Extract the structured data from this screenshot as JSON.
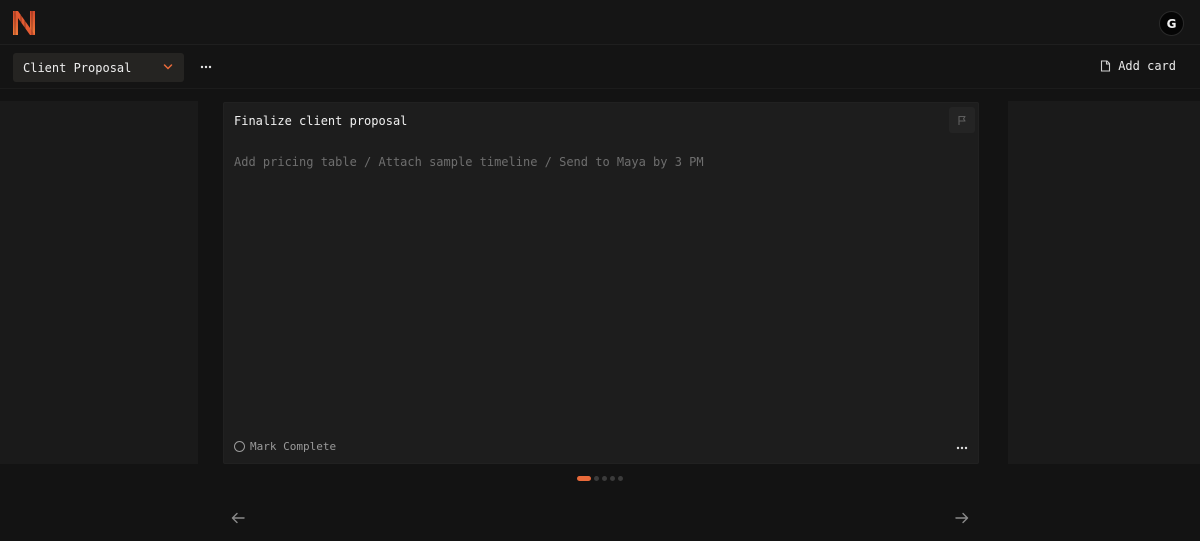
{
  "header": {
    "logo_icon": "netflix-style-n-logo-icon",
    "user_initial": "G"
  },
  "toolbar": {
    "board_name": "Client Proposal",
    "more_label": "…",
    "add_card_label": "Add card"
  },
  "card": {
    "title": "Finalize client proposal",
    "description": "Add pricing table / Attach sample timeline / Send to Maya by 3 PM",
    "mark_complete_label": "Mark Complete",
    "more_label": "…"
  },
  "pagination": {
    "total": 5,
    "active_index": 0
  },
  "colors": {
    "accent": "#e96a3a",
    "background": "#131313",
    "card": "#1d1d1d"
  }
}
